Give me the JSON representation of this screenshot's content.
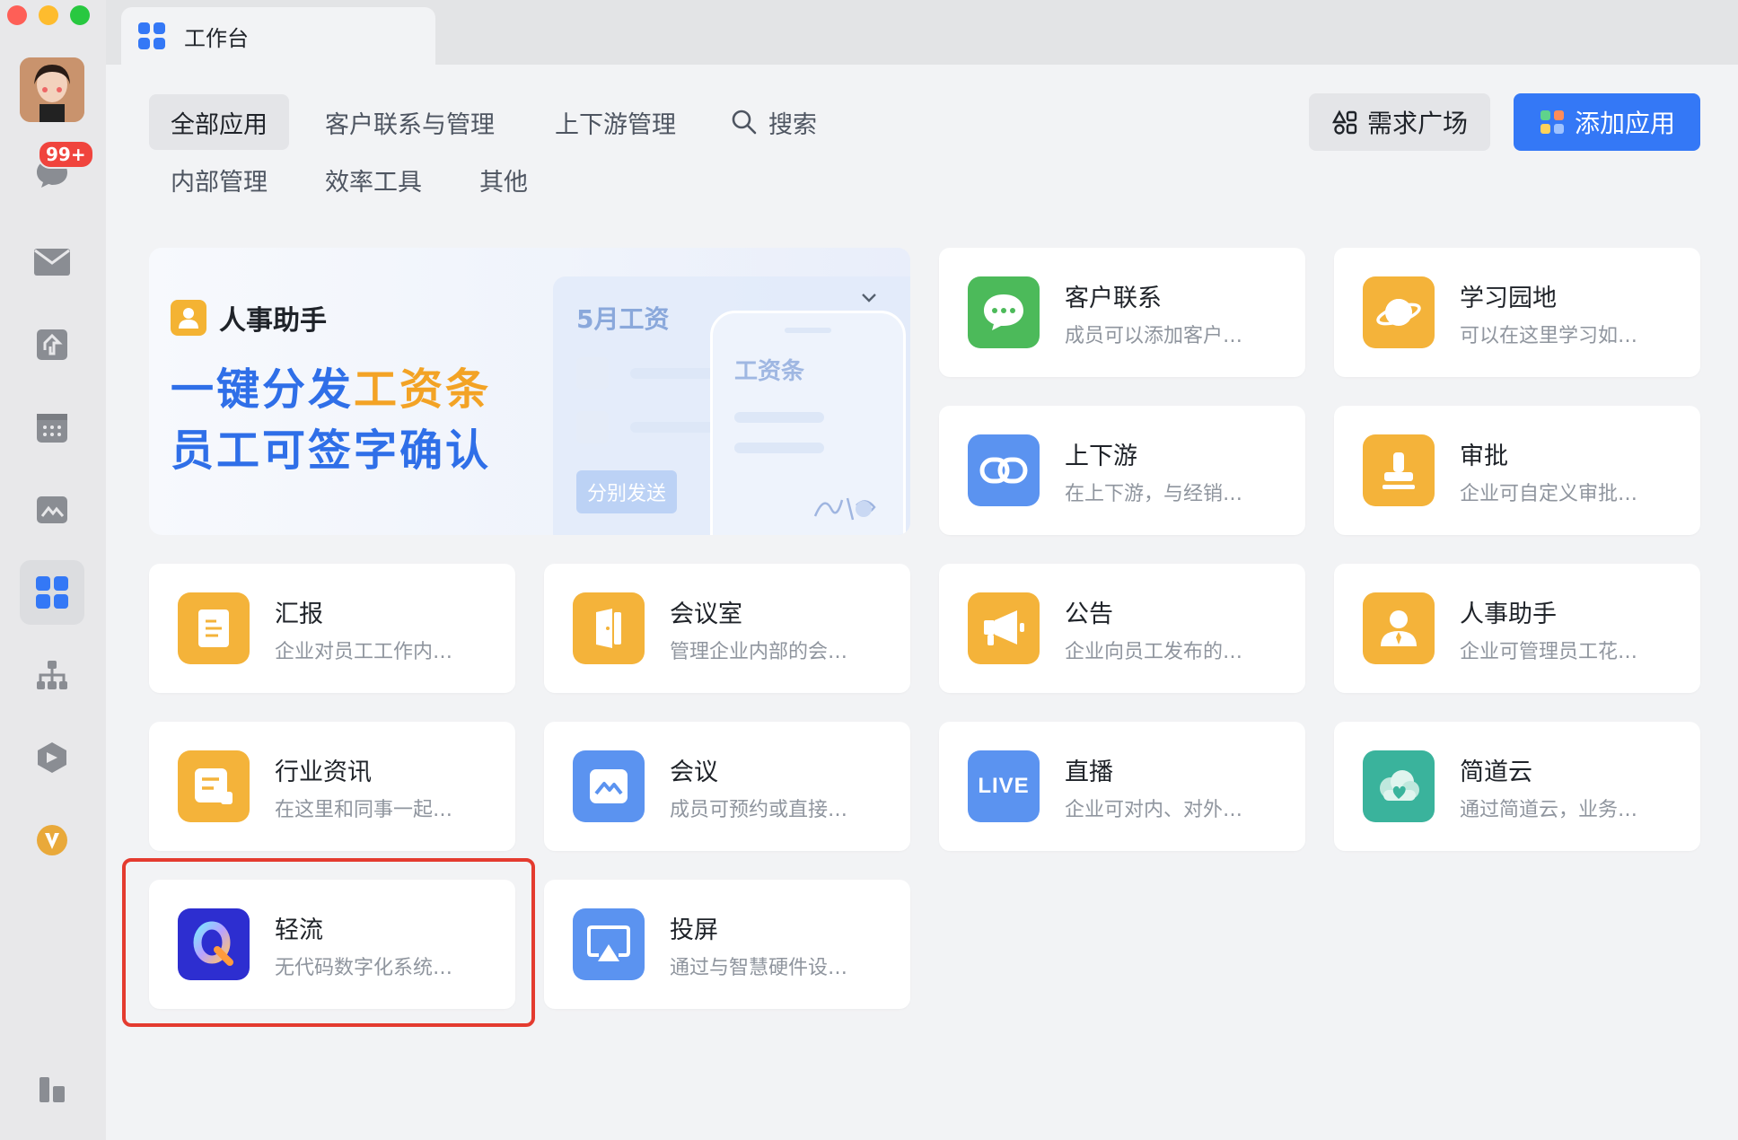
{
  "tab": {
    "title": "工作台"
  },
  "sidebar": {
    "badge": "99+"
  },
  "nav": {
    "row1": [
      "全部应用",
      "客户联系与管理",
      "上下游管理"
    ],
    "search_label": "搜索",
    "row2": [
      "内部管理",
      "效率工具",
      "其他"
    ]
  },
  "buttons": {
    "demand_plaza": "需求广场",
    "add_app": "添加应用"
  },
  "banner": {
    "app_name": "人事助手",
    "line1_prefix": "一键分发",
    "line1_highlight": "工资条",
    "line2": "员工可签字确认",
    "panel_title": "5月工资",
    "panel_button": "分别发送",
    "phone_title": "工资条"
  },
  "apps": [
    {
      "title": "客户联系",
      "desc": "成员可以添加客户…"
    },
    {
      "title": "学习园地",
      "desc": "可以在这里学习如…"
    },
    {
      "title": "上下游",
      "desc": "在上下游，与经销…"
    },
    {
      "title": "审批",
      "desc": "企业可自定义审批…"
    },
    {
      "title": "汇报",
      "desc": "企业对员工工作内…"
    },
    {
      "title": "会议室",
      "desc": "管理企业内部的会…"
    },
    {
      "title": "公告",
      "desc": "企业向员工发布的…"
    },
    {
      "title": "人事助手",
      "desc": "企业可管理员工花…"
    },
    {
      "title": "行业资讯",
      "desc": "在这里和同事一起…"
    },
    {
      "title": "会议",
      "desc": "成员可预约或直接…"
    },
    {
      "title": "直播",
      "desc": "企业可对内、对外…",
      "icon_text": "LIVE"
    },
    {
      "title": "简道云",
      "desc": "通过简道云，业务…"
    },
    {
      "title": "轻流",
      "desc": "无代码数字化系统…"
    },
    {
      "title": "投屏",
      "desc": "通过与智慧硬件设…"
    }
  ],
  "colors": {
    "primary": "#3478f6",
    "highlight_border": "#e43b2f",
    "icon_orange": "#f4b33a",
    "icon_green": "#4cba5a",
    "icon_blue": "#5b93f0"
  }
}
